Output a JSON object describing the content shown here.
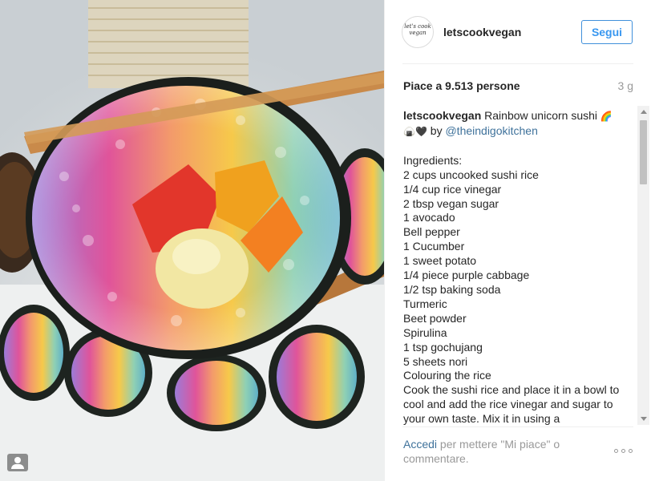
{
  "post": {
    "username": "letscookvegan",
    "avatar_text": "let's cook vegan",
    "follow_label": "Segui",
    "likes": "Piace a 9.513 persone",
    "time_ago": "3 g",
    "caption_user": "letscookvegan",
    "caption_title": "Rainbow unicorn sushi",
    "caption_title_emoji": "🌈",
    "caption_line2_emoji": "🍙🖤",
    "by_text": "by",
    "mention": "@theindigokitchen",
    "caption_lines": [
      "Ingredients:",
      "2 cups uncooked sushi rice",
      "1/4 cup rice vinegar",
      "2 tbsp vegan sugar",
      "1 avocado",
      "Bell pepper",
      "1 Cucumber",
      "1 sweet potato",
      "1/4 piece purple cabbage",
      "1/2 tsp baking soda",
      "Turmeric",
      "Beet powder",
      "Spirulina",
      "1 tsp gochujang",
      "5 sheets nori",
      "Colouring the rice",
      "Cook the sushi rice and place it in a bowl to cool and add the rice vinegar and sugar to your own taste. Mix it in using a"
    ]
  },
  "footer": {
    "login_link": "Accedi",
    "rest": "per mettere \"Mi piace\" o commentare."
  },
  "icons": {
    "more": "more-options-icon",
    "tag": "user-tag-icon"
  }
}
